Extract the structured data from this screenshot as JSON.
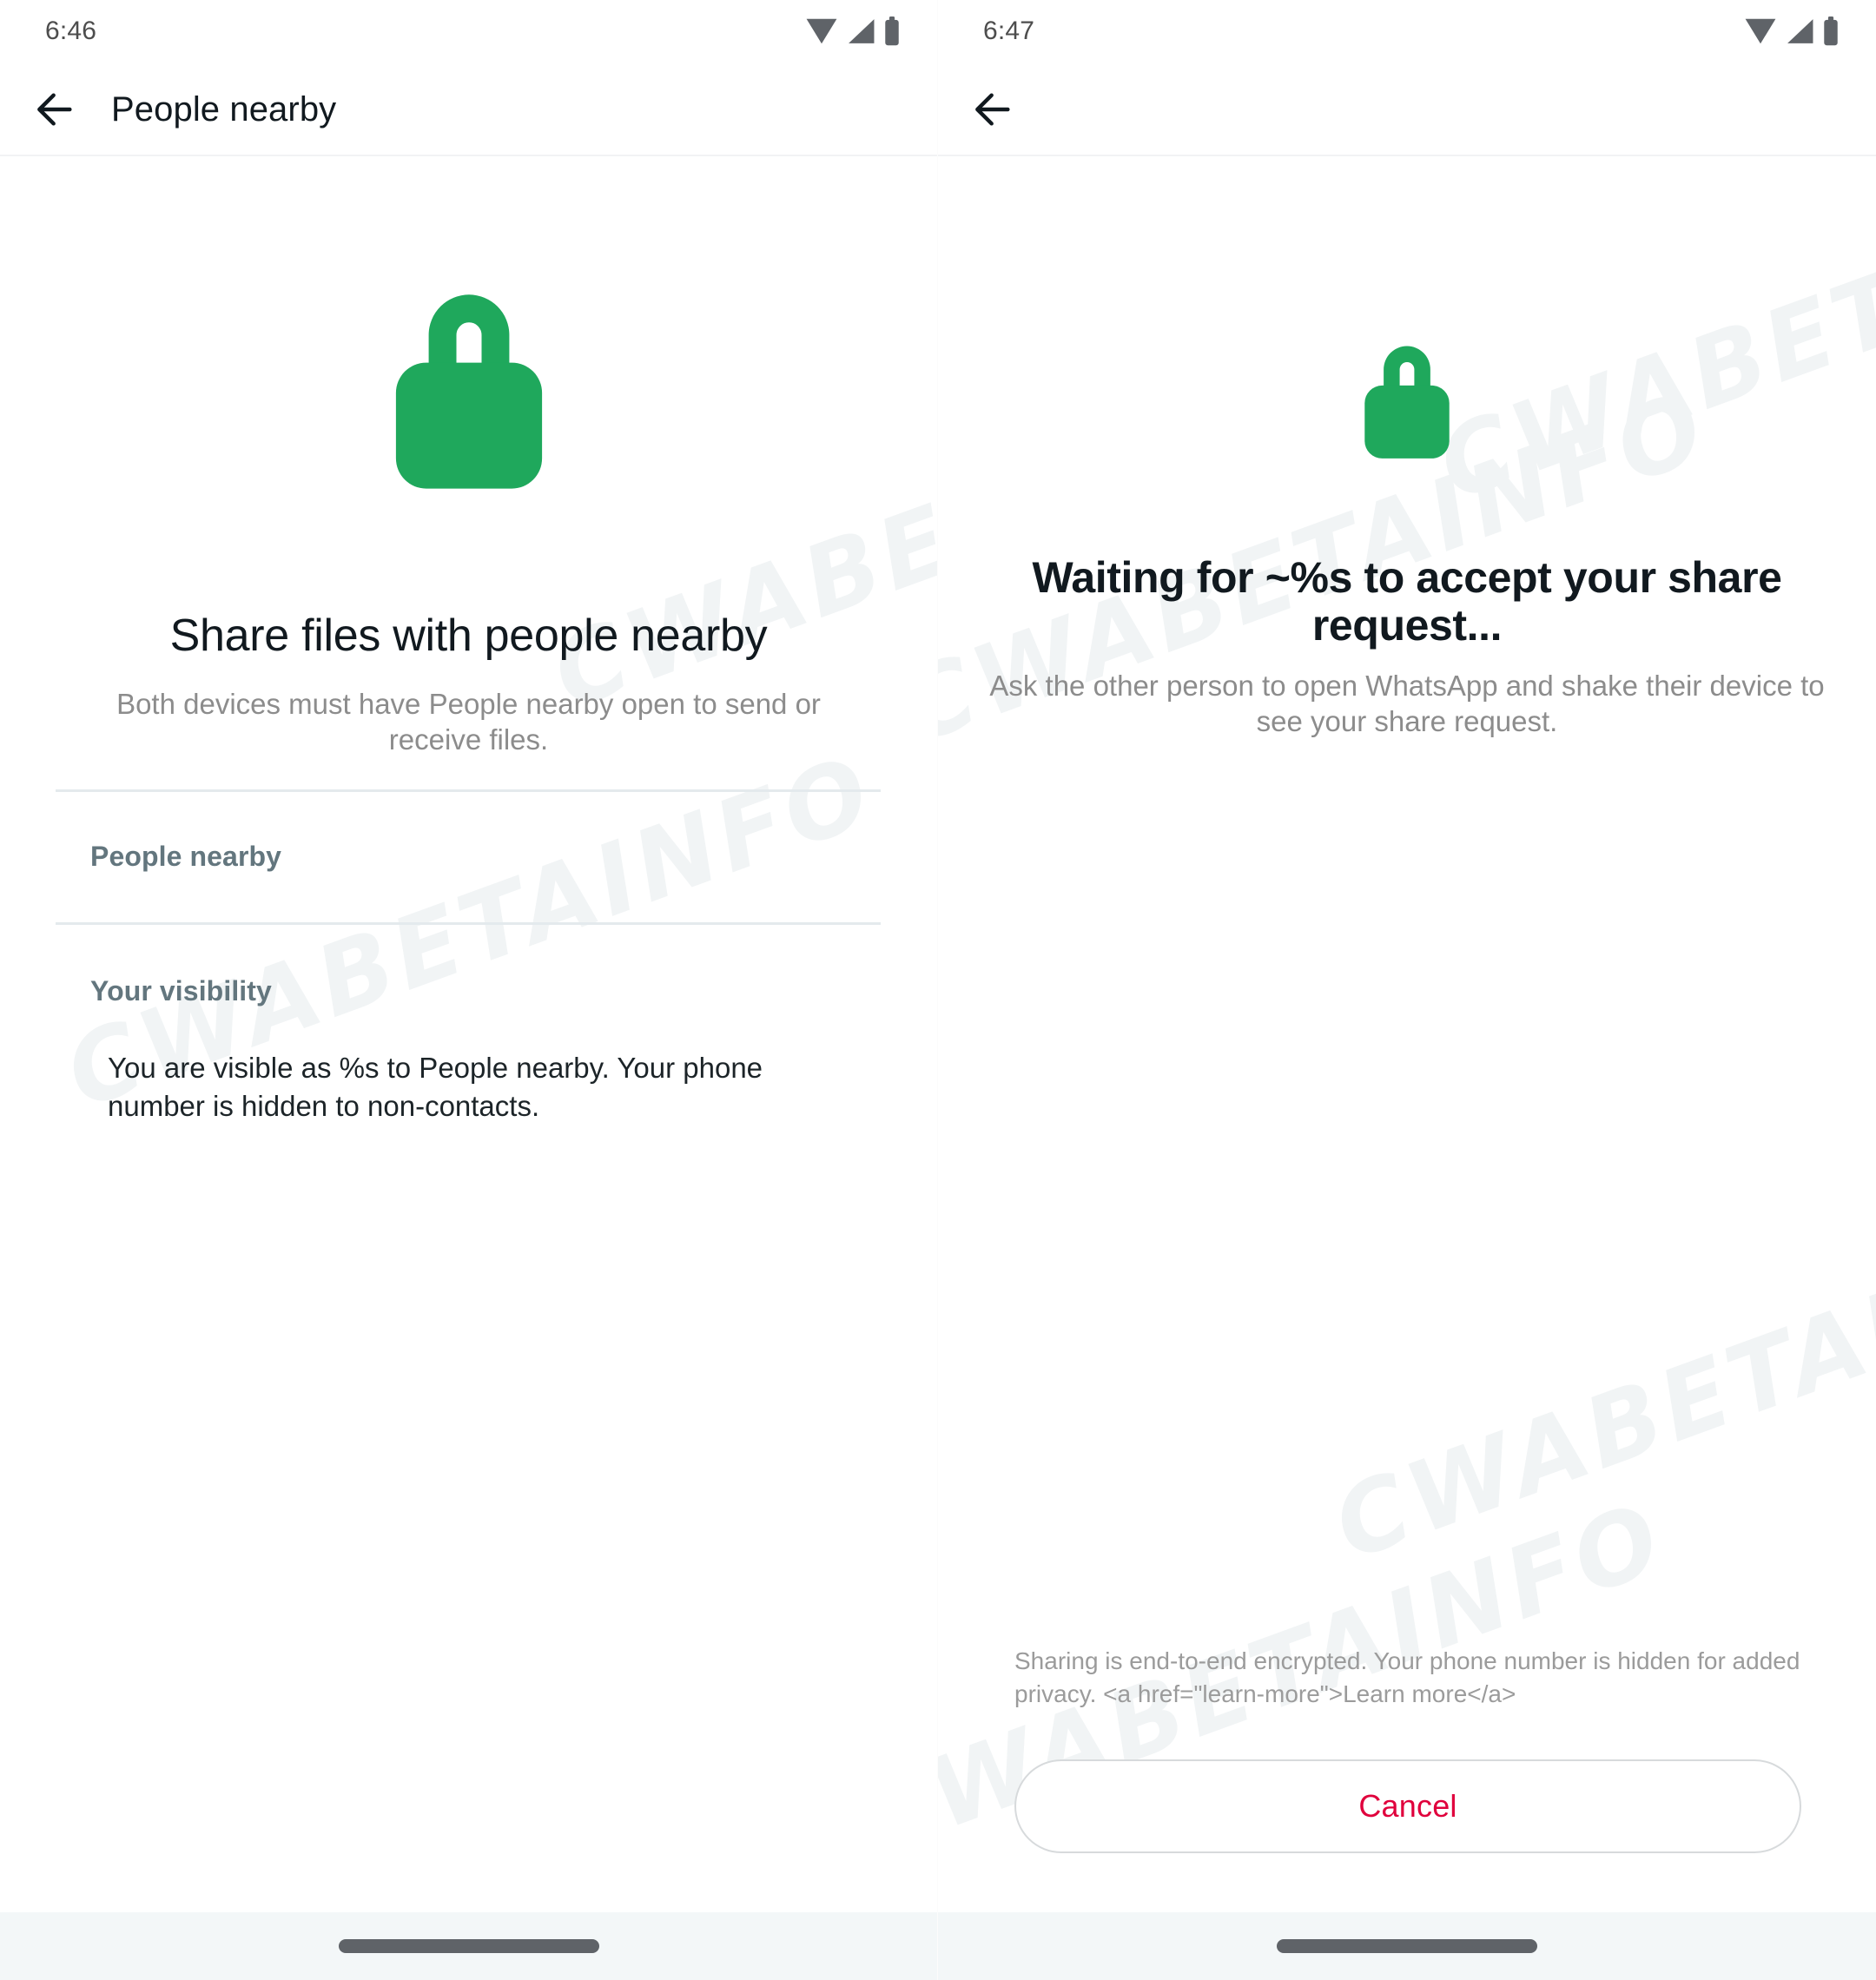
{
  "watermark": {
    "text": "CWABETAINFO"
  },
  "brand": {
    "lock_green": "#1fa85c",
    "accent_red": "#e0003c",
    "section_label_color": "#63767e",
    "nav_background": "#f3f7f8"
  },
  "panels": [
    {
      "id": "people-nearby",
      "status": {
        "time": "6:46",
        "icons": [
          "wifi-icon",
          "cellular-signal-icon",
          "battery-icon"
        ]
      },
      "app_bar": {
        "back_icon": "back-arrow-icon",
        "title": "People nearby"
      },
      "hero": {
        "icon": "lock-icon",
        "title": "Share files with people nearby",
        "subtitle": "Both devices must have People nearby open to send or receive files."
      },
      "list": {
        "row_label": "People nearby"
      },
      "visibility": {
        "header": "Your visibility",
        "body": "You are visible as %s to People nearby. Your phone number is hidden to non-contacts."
      }
    },
    {
      "id": "waiting-for-accept",
      "status": {
        "time": "6:47",
        "icons": [
          "wifi-icon",
          "cellular-signal-icon",
          "battery-icon"
        ]
      },
      "app_bar": {
        "back_icon": "back-arrow-icon",
        "title": ""
      },
      "hero": {
        "icon": "lock-icon",
        "title": "Waiting for ~%s to accept your share request...",
        "subtitle": "Ask the other person to open WhatsApp and shake their device to see your share request."
      },
      "footnote": "Sharing is end-to-end encrypted. Your phone number is hidden for added privacy. <a href=\"learn-more\">Learn more</a>",
      "cancel_button": {
        "label": "Cancel"
      }
    }
  ]
}
